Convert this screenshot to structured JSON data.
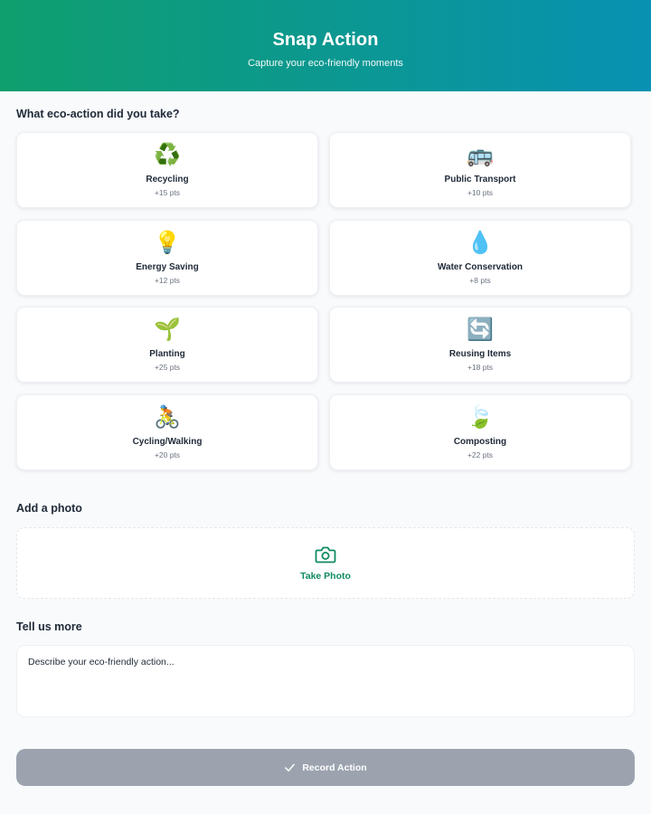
{
  "header": {
    "title": "Snap Action",
    "subtitle": "Capture your eco-friendly moments"
  },
  "actions_section": {
    "title": "What eco-action did you take?",
    "items": [
      {
        "icon": "recycling-icon",
        "emoji": "♻️",
        "label": "Recycling",
        "points": "+15 pts"
      },
      {
        "icon": "bus-icon",
        "emoji": "🚌",
        "label": "Public Transport",
        "points": "+10 pts"
      },
      {
        "icon": "lightbulb-icon",
        "emoji": "💡",
        "label": "Energy Saving",
        "points": "+12 pts"
      },
      {
        "icon": "water-drop-icon",
        "emoji": "💧",
        "label": "Water Conservation",
        "points": "+8 pts"
      },
      {
        "icon": "seedling-icon",
        "emoji": "🌱",
        "label": "Planting",
        "points": "+25 pts"
      },
      {
        "icon": "cycle-arrows-icon",
        "emoji": "🔄",
        "label": "Reusing Items",
        "points": "+18 pts"
      },
      {
        "icon": "cyclist-icon",
        "emoji": "🚴",
        "label": "Cycling/Walking",
        "points": "+20 pts"
      },
      {
        "icon": "leaf-icon",
        "emoji": "🍃",
        "label": "Composting",
        "points": "+22 pts"
      }
    ]
  },
  "photo_section": {
    "title": "Add a photo",
    "button_label": "Take Photo",
    "icon": "camera-icon"
  },
  "details_section": {
    "title": "Tell us more",
    "placeholder": "Describe your eco-friendly action...",
    "value": ""
  },
  "submit": {
    "label": "Record Action",
    "icon": "checkmark-icon"
  },
  "colors": {
    "header_gradient_start": "#0f9f6e",
    "header_gradient_end": "#0891b2",
    "accent": "#0f8a63",
    "submit_disabled": "#9ca3af"
  }
}
